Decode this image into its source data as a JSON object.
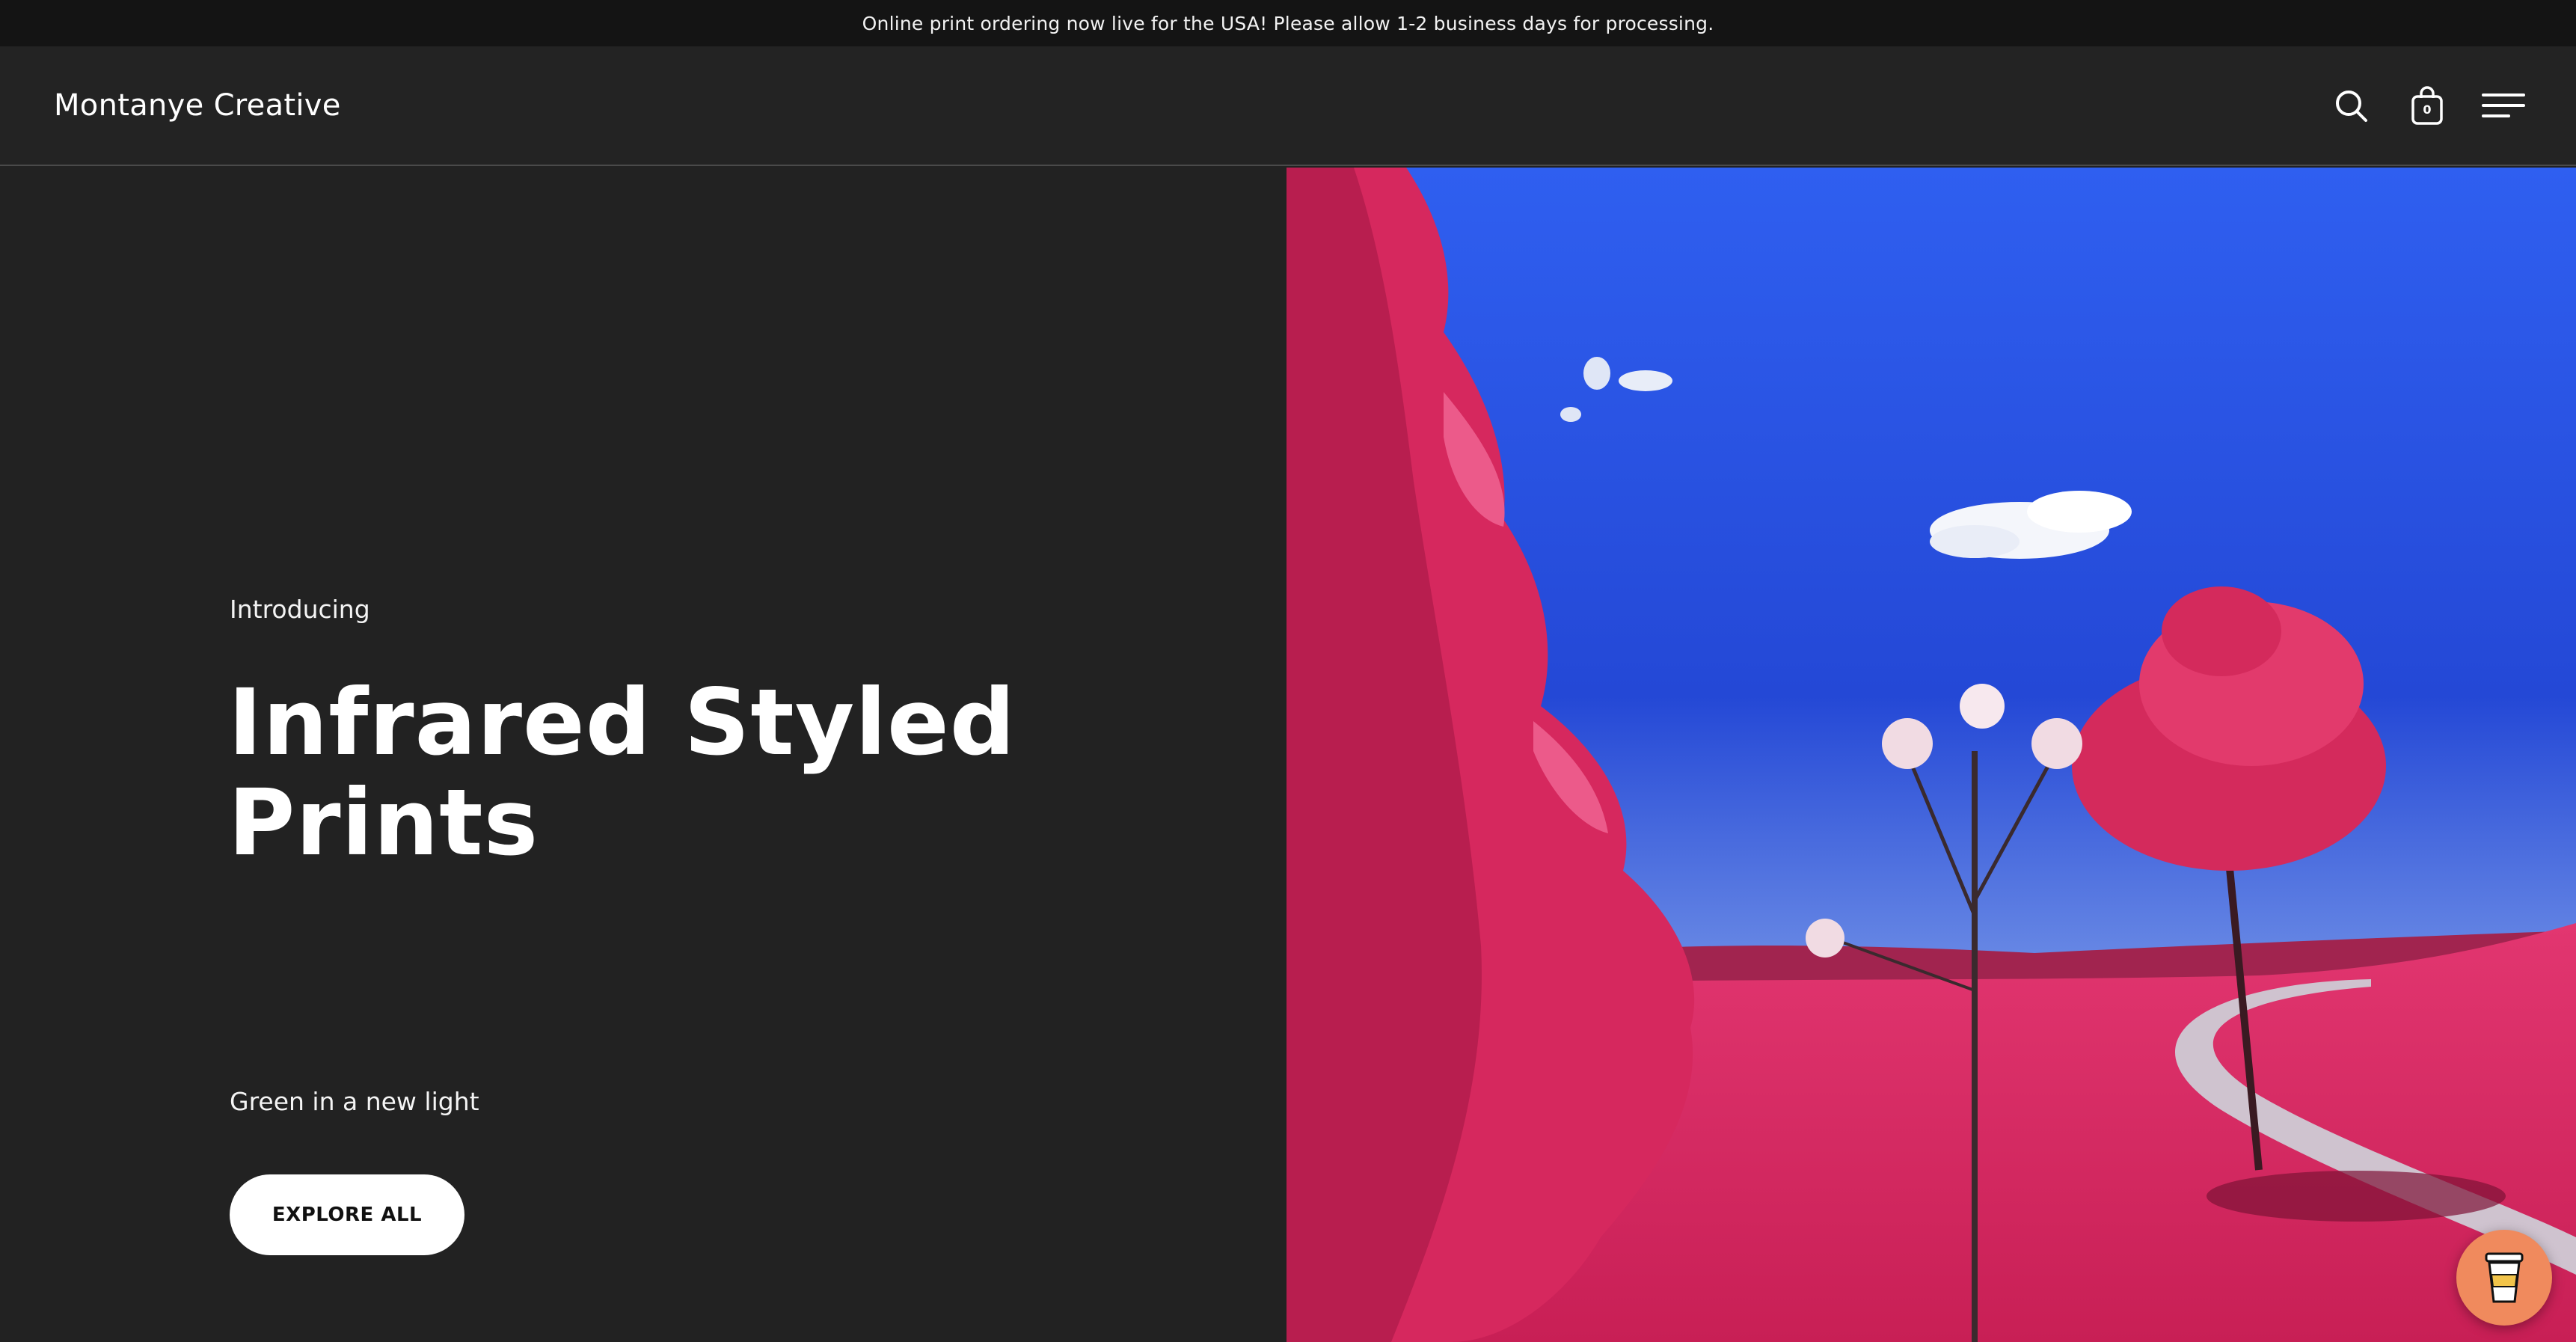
{
  "announcement": {
    "text": "Online print ordering now live for the USA! Please allow 1-2 business days for processing."
  },
  "header": {
    "brand": "Montanye Creative",
    "icons": {
      "search": "search-icon",
      "cart": "shopping-bag-icon",
      "menu": "hamburger-menu-icon"
    },
    "cart_count": "0"
  },
  "hero": {
    "eyebrow": "Introducing",
    "headline": "Infrared Styled Prints",
    "subline": "Green in a new light",
    "cta_label": "EXPLORE ALL",
    "image_subject": "infrared landscape photo: magenta trees and grass, blue sky, winding path"
  },
  "widget": {
    "icon": "coffee-cup-icon"
  },
  "colors": {
    "background": "#222222",
    "announcement_bg": "#141414",
    "button_bg": "#ffffff",
    "sky": "#2f5ff0",
    "foliage": "#d6285e",
    "widget": "#f08a5d"
  }
}
